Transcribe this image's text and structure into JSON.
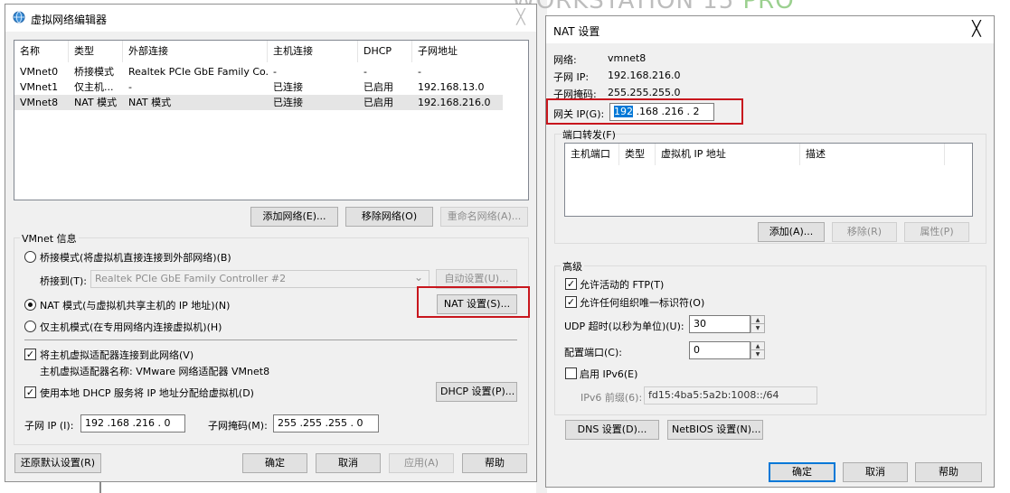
{
  "banner": {
    "text": "WORKSTATION 15 ",
    "pro": "PRO"
  },
  "left_window": {
    "title": "虚拟网络编辑器",
    "close": "╳",
    "columns": [
      "名称",
      "类型",
      "外部连接",
      "主机连接",
      "DHCP",
      "子网地址"
    ],
    "rows": [
      [
        "VMnet0",
        "桥接模式",
        "Realtek PCIe GbE Family Co...",
        "-",
        "-",
        "-"
      ],
      [
        "VMnet1",
        "仅主机...",
        "-",
        "已连接",
        "已启用",
        "192.168.13.0"
      ],
      [
        "VMnet8",
        "NAT 模式",
        "NAT 模式",
        "已连接",
        "已启用",
        "192.168.216.0"
      ]
    ],
    "add_network": "添加网络(E)...",
    "remove_network": "移除网络(O)",
    "rename_network": "重命名网络(A)...",
    "vmnet_info": "VMnet 信息",
    "bridge_mode": "桥接模式(将虚拟机直接连接到外部网络)(B)",
    "bridge_to_label": "桥接到(T):",
    "bridge_to_value": "Realtek PCIe GbE Family Controller #2",
    "auto_settings": "自动设置(U)...",
    "nat_mode": "NAT 模式(与虚拟机共享主机的 IP 地址)(N)",
    "nat_settings": "NAT 设置(S)...",
    "host_only": "仅主机模式(在专用网络内连接虚拟机)(H)",
    "connect_adapter": "将主机虚拟适配器连接到此网络(V)",
    "adapter_name": "主机虚拟适配器名称: VMware 网络适配器 VMnet8",
    "use_dhcp": "使用本地 DHCP 服务将 IP 地址分配给虚拟机(D)",
    "dhcp_settings": "DHCP 设置(P)...",
    "subnet_ip_label": "子网 IP (I):",
    "subnet_ip": "192 .168 .216 .  0",
    "subnet_mask_label": "子网掩码(M):",
    "subnet_mask": "255 .255 .255 .  0",
    "restore_defaults": "还原默认设置(R)",
    "ok": "确定",
    "cancel": "取消",
    "apply": "应用(A)",
    "help": "帮助"
  },
  "nat_window": {
    "title": "NAT 设置",
    "close": "╳",
    "network_label": "网络:",
    "network_value": "vmnet8",
    "subnet_ip_label": "子网 IP:",
    "subnet_ip_value": "192.168.216.0",
    "subnet_mask_label": "子网掩码:",
    "subnet_mask_value": "255.255.255.0",
    "gateway_label": "网关 IP(G):",
    "gateway_selected": "192",
    "gateway_rest": " .168 .216 .  2",
    "port_forwarding": "端口转发(F)",
    "pf_columns": [
      "主机端口",
      "类型",
      "虚拟机 IP 地址",
      "描述"
    ],
    "add": "添加(A)...",
    "remove": "移除(R)",
    "properties": "属性(P)",
    "advanced": "高级",
    "allow_ftp": "允许活动的 FTP(T)",
    "allow_oui": "允许任何组织唯一标识符(O)",
    "udp_timeout_label": "UDP 超时(以秒为单位)(U):",
    "udp_timeout": "30",
    "config_port_label": "配置端口(C):",
    "config_port": "0",
    "enable_ipv6": "启用 IPv6(E)",
    "ipv6_prefix_label": "IPv6 前缀(6):",
    "ipv6_prefix": "fd15:4ba5:5a2b:1008::/64",
    "dns_settings": "DNS 设置(D)...",
    "netbios_settings": "NetBIOS 设置(N)...",
    "ok": "确定",
    "cancel": "取消",
    "help": "帮助"
  },
  "glyphs": {
    "check": "✓",
    "up": "▲",
    "down": "▼",
    "chevron": "⌄"
  }
}
